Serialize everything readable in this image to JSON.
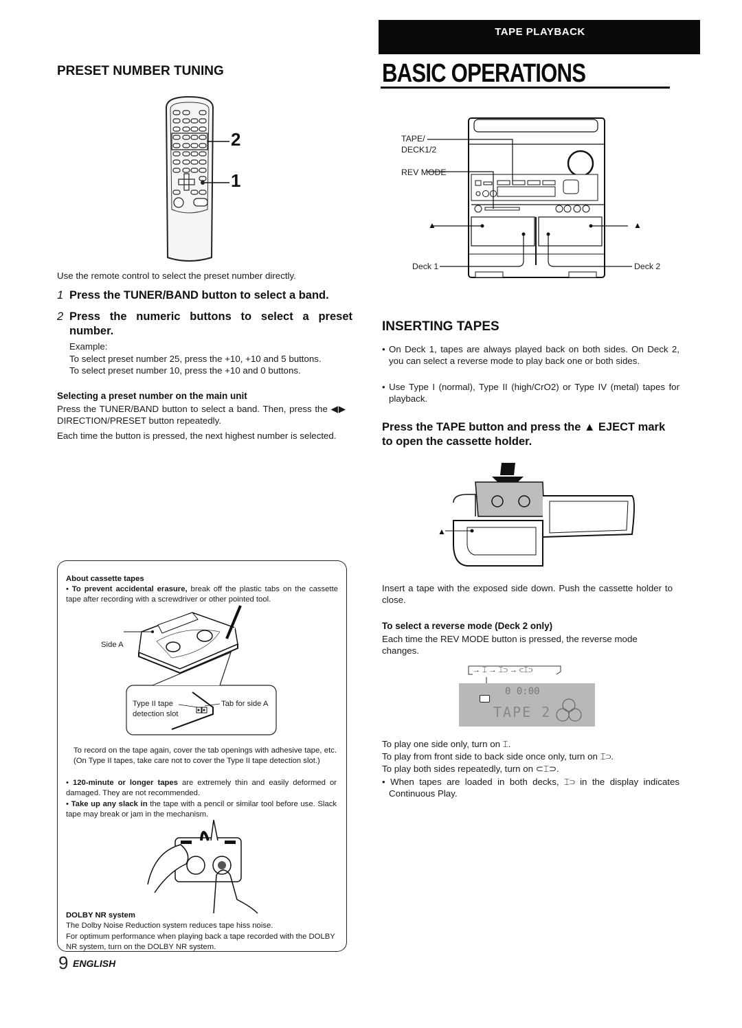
{
  "header": {
    "band_label": "TAPE PLAYBACK",
    "title": "BASIC OPERATIONS"
  },
  "left": {
    "section_title": "PRESET NUMBER TUNING",
    "remote_callouts": [
      "2",
      "1"
    ],
    "intro": "Use the remote control to select the preset number directly.",
    "steps": [
      {
        "num": "1",
        "text": "Press the TUNER/BAND button to select a band."
      },
      {
        "num": "2",
        "text": "Press the numeric buttons to select a preset number."
      }
    ],
    "example_label": "Example:",
    "example_lines": [
      "To select preset number 25, press the +10, +10 and 5 buttons.",
      "To select preset number 10, press the +10 and 0 buttons."
    ],
    "main_unit_heading": "Selecting a preset number on the main unit",
    "main_unit_lines": [
      "Press the TUNER/BAND button to select a band. Then, press the ◀▶ DIRECTION/PRESET button repeatedly.",
      "Each time the button is pressed, the next highest number is selected."
    ]
  },
  "notes": {
    "heading": "About cassette tapes",
    "bullet1_bold": "To prevent accidental erasure,",
    "bullet1_text": " break off the plastic tabs on the cassette tape after recording with a screwdriver or other pointed tool.",
    "side_a_label": "Side A",
    "type2_label": "Type II tape detection slot",
    "tab_label": "Tab for side A",
    "record_again": "To record on the tape again, cover the tab openings with adhesive tape, etc. (On Type II tapes, take care not to cover the Type II tape detection slot.)",
    "bullet2_bold": "120-minute or longer tapes",
    "bullet2_text": " are extremely thin and easily deformed or damaged. They are not recommended.",
    "bullet3_bold": "Take up any slack in",
    "bullet3_text": " the tape with a pencil or similar tool before use. Slack tape may break or jam in the mechanism.",
    "dolby_heading": "DOLBY NR system",
    "dolby_lines": [
      "The Dolby Noise Reduction system reduces tape hiss noise.",
      "For optimum performance when playing back a tape recorded with the DOLBY NR system, turn on the DOLBY NR  system."
    ]
  },
  "right": {
    "diagram_labels": {
      "tape_deck": "TAPE/ DECK1/2",
      "rev_mode": "REV MODE",
      "deck1": "Deck 1",
      "deck2": "Deck 2",
      "eject": "▲"
    },
    "section_title": "INSERTING TAPES",
    "bullets": [
      "On Deck 1, tapes are always played back on both sides. On Deck 2, you can select a reverse mode to play back one or both sides.",
      "Use Type I (normal), Type II (high/CrO2) or Type IV (metal) tapes for playback."
    ],
    "instruction": "Press the TAPE button and press the ▲ EJECT mark to open the cassette holder.",
    "insert_text": "Insert a tape with the exposed side down. Push the cassette holder to close.",
    "reverse_heading": "To select a reverse mode (Deck 2 only)",
    "reverse_text": "Each time the REV MODE button is pressed, the reverse mode changes.",
    "mode_sequence": "→ ⌶ → ⌶⊃ → ⊂⌶⊃",
    "display_time": "0 0:00",
    "display_text": "TAPE 2",
    "mode_lines": [
      "To play one side only, turn on ⌶.",
      "To play from front side to back side once only, turn on ⌶⊃.",
      "To play both sides repeatedly, turn on ⊂⌶⊃."
    ],
    "continuous_note": "When tapes are loaded in both decks, ⌶⊃ in the display indicates Continuous Play."
  },
  "footer": {
    "page_number": "9",
    "language": "ENGLISH"
  }
}
